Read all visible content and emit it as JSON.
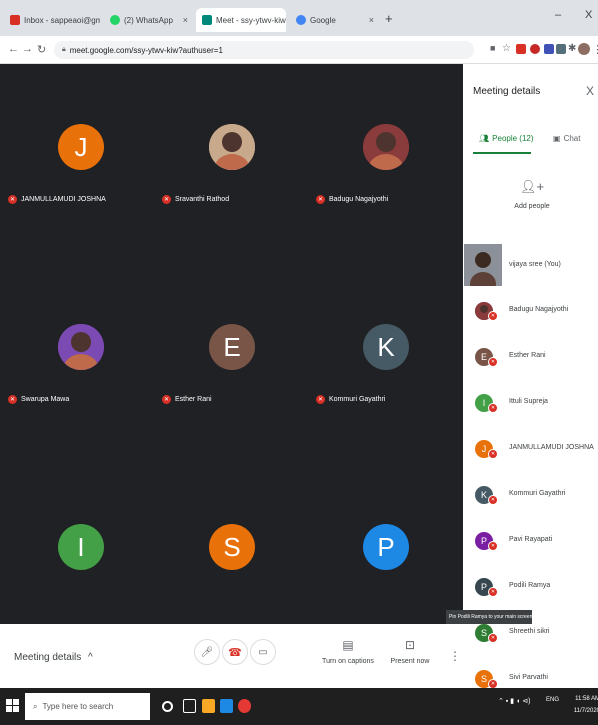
{
  "browser": {
    "tabs": [
      {
        "title": "Inbox - sappeaoi@gmail.com",
        "favicon_color": "#d93025"
      },
      {
        "title": "(2) WhatsApp",
        "favicon_color": "#25d366"
      },
      {
        "title": "Meet - ssy-ytwv-kiw",
        "favicon_color": "#00897b"
      },
      {
        "title": "Google",
        "favicon_color": "#4285f4"
      }
    ],
    "url": "meet.google.com/ssy-ytwv-kiw?authuser=1",
    "new_tab": "+",
    "close_glyph": "X",
    "minimize_glyph": "–"
  },
  "meeting": {
    "tiles": [
      {
        "name": "JANMULLAMUDI JOSHNA",
        "initial": "J",
        "color": "#e8710a",
        "photo": false
      },
      {
        "name": "Sravanthi Rathod",
        "initial": "",
        "color": "#c9a98c",
        "photo": true
      },
      {
        "name": "Badugu Nagajyothi",
        "initial": "",
        "color": "#8a3b3b",
        "photo": true
      },
      {
        "name": "Swarupa Mawa",
        "initial": "",
        "color": "#7b4ab3",
        "photo": true
      },
      {
        "name": "Esther Rani",
        "initial": "E",
        "color": "#795548",
        "photo": false
      },
      {
        "name": "Kommuri Gayathri",
        "initial": "K",
        "color": "#455a64",
        "photo": false
      },
      {
        "name": "",
        "initial": "I",
        "color": "#43a047",
        "photo": false
      },
      {
        "name": "",
        "initial": "S",
        "color": "#e8710a",
        "photo": false
      },
      {
        "name": "",
        "initial": "P",
        "color": "#1e88e5",
        "photo": false
      }
    ],
    "controls": {
      "meeting_details": "Meeting details",
      "meeting_details_chevron": "^",
      "captions_label": "Turn on captions",
      "present_label": "Present now",
      "more_glyph": "⋮"
    }
  },
  "panel": {
    "title": "Meeting details",
    "close": "X",
    "tab_people": "People (12)",
    "tab_chat": "Chat",
    "add_people": "Add people",
    "self_name": "vijaya sree (You)",
    "people": [
      {
        "name": "Badugu Nagajyothi",
        "initial": "",
        "color": "#8a3b3b",
        "photo": true
      },
      {
        "name": "Esther Rani",
        "initial": "E",
        "color": "#795548",
        "photo": false
      },
      {
        "name": "Ittuli Supreja",
        "initial": "I",
        "color": "#43a047",
        "photo": false
      },
      {
        "name": "JANMULLAMUDI JOSHNA",
        "initial": "J",
        "color": "#e8710a",
        "photo": false
      },
      {
        "name": "Kommuri Gayathri",
        "initial": "K",
        "color": "#455a64",
        "photo": false
      },
      {
        "name": "Pavi Rayapati",
        "initial": "P",
        "color": "#7b1fa2",
        "photo": false
      },
      {
        "name": "Podili Ramya",
        "initial": "P",
        "color": "#37474f",
        "photo": false
      },
      {
        "name": "Shreethi sikri",
        "initial": "S",
        "color": "#2e7d32",
        "photo": false
      },
      {
        "name": "Sivi Parvathi",
        "initial": "S",
        "color": "#e8710a",
        "photo": false
      }
    ],
    "tooltip": "Pin Podili Ramya to your main screen"
  },
  "taskbar": {
    "search_placeholder": "Type here to search",
    "tray_lang": "ENG\nIN",
    "time": "11:58 AM",
    "date": "11/7/2020"
  }
}
